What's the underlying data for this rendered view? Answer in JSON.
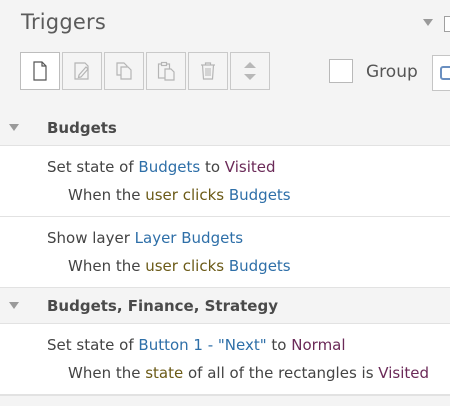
{
  "panel": {
    "title": "Triggers",
    "toolbar": {
      "buttons": [
        {
          "name": "new-trigger",
          "icon": "new-document-icon"
        },
        {
          "name": "edit-trigger",
          "icon": "edit-icon"
        },
        {
          "name": "copy-trigger",
          "icon": "copy-icon"
        },
        {
          "name": "paste-trigger",
          "icon": "paste-icon"
        },
        {
          "name": "delete-trigger",
          "icon": "trash-icon"
        },
        {
          "name": "reorder-trigger",
          "icon": "up-down-arrows-icon"
        }
      ],
      "group_label": "Group",
      "group_checked": false
    }
  },
  "groups": [
    {
      "name": "Budgets",
      "triggers": [
        {
          "line1": [
            {
              "text": "Set state of ",
              "kind": "plain"
            },
            {
              "text": "Budgets",
              "kind": "obj"
            },
            {
              "text": " to ",
              "kind": "plain"
            },
            {
              "text": "Visited",
              "kind": "state"
            }
          ],
          "line2": [
            {
              "text": "When the ",
              "kind": "plain"
            },
            {
              "text": "user",
              "kind": "user"
            },
            {
              "text": " ",
              "kind": "plain"
            },
            {
              "text": "clicks",
              "kind": "user"
            },
            {
              "text": " ",
              "kind": "plain"
            },
            {
              "text": "Budgets",
              "kind": "obj"
            }
          ]
        },
        {
          "line1": [
            {
              "text": "Show layer ",
              "kind": "plain"
            },
            {
              "text": "Layer Budgets",
              "kind": "obj"
            }
          ],
          "line2": [
            {
              "text": "When the ",
              "kind": "plain"
            },
            {
              "text": "user",
              "kind": "user"
            },
            {
              "text": " ",
              "kind": "plain"
            },
            {
              "text": "clicks",
              "kind": "user"
            },
            {
              "text": " ",
              "kind": "plain"
            },
            {
              "text": "Budgets",
              "kind": "obj"
            }
          ]
        }
      ]
    },
    {
      "name": "Budgets, Finance, Strategy",
      "triggers": [
        {
          "line1": [
            {
              "text": "Set state of ",
              "kind": "plain"
            },
            {
              "text": "Button 1 - \"Next\"",
              "kind": "obj"
            },
            {
              "text": " to ",
              "kind": "plain"
            },
            {
              "text": "Normal",
              "kind": "state"
            }
          ],
          "line2": [
            {
              "text": "When the ",
              "kind": "plain"
            },
            {
              "text": "state",
              "kind": "user"
            },
            {
              "text": " of all of the rectangles is ",
              "kind": "plain"
            },
            {
              "text": "Visited",
              "kind": "state"
            }
          ]
        }
      ]
    }
  ],
  "colors": {
    "object": "#2e6fa8",
    "state": "#6b2a58",
    "user_action": "#6b5a17",
    "header_bg": "#f4f4f4"
  }
}
